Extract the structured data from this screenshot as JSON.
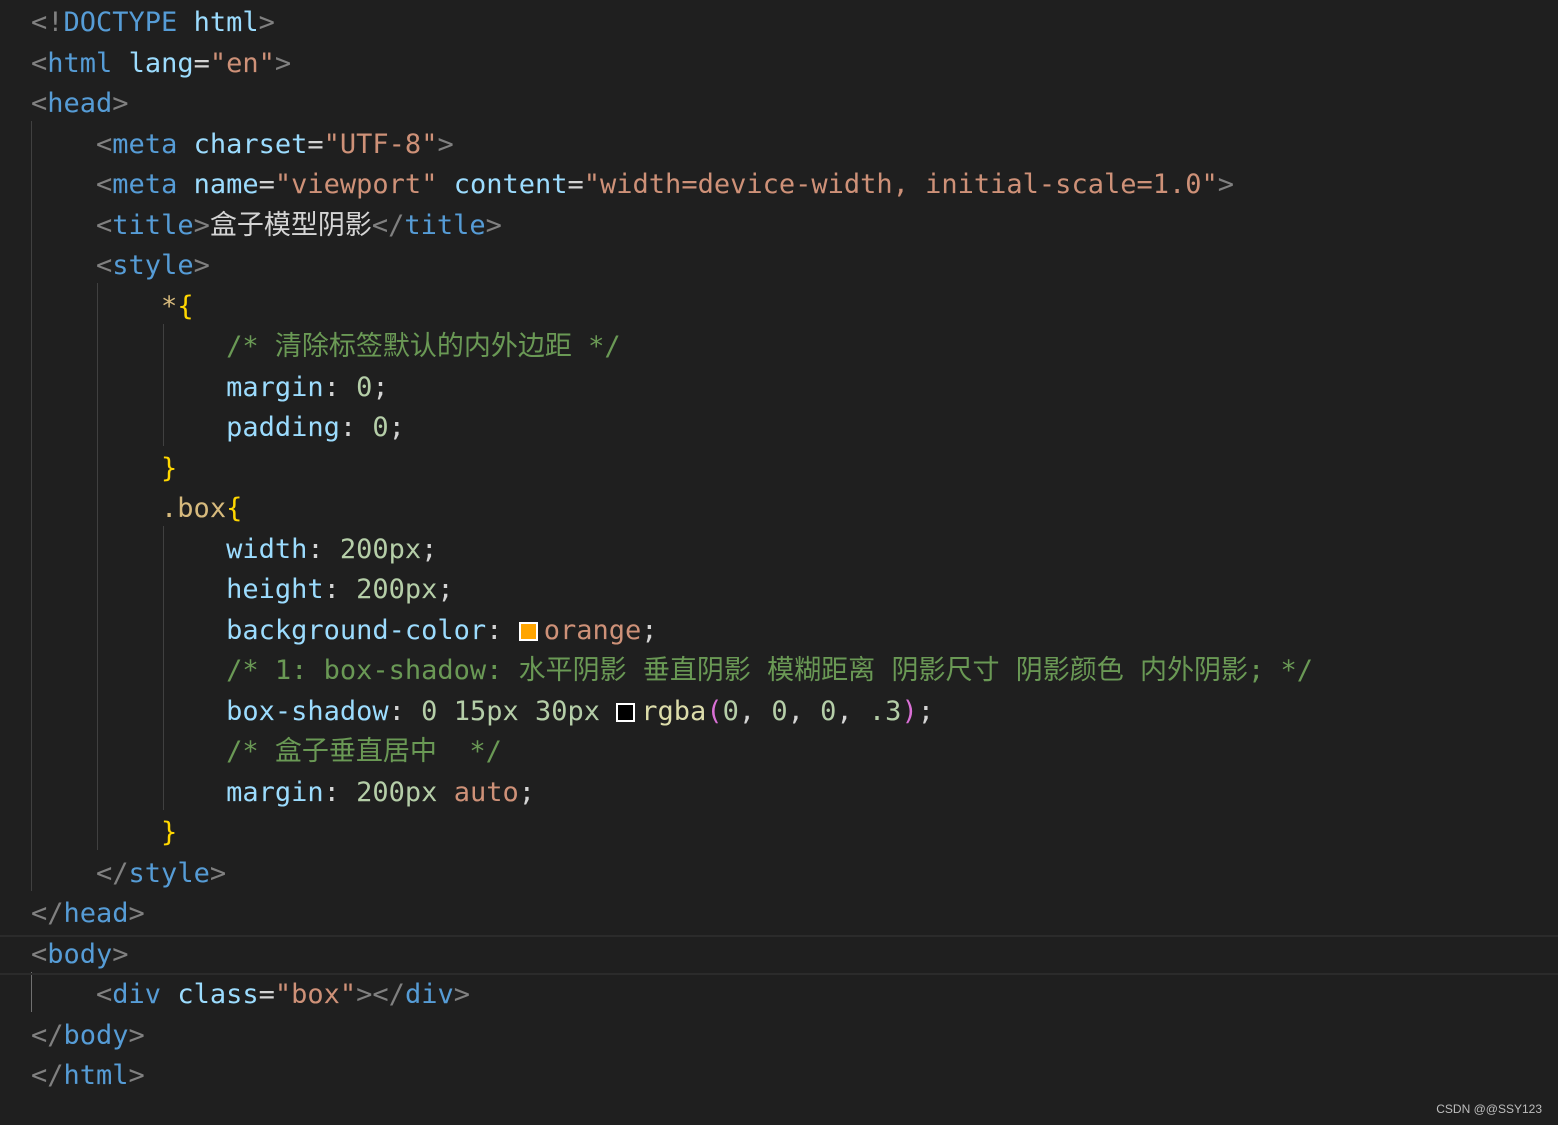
{
  "lines": [
    [
      {
        "c": "punc",
        "t": "<!"
      },
      {
        "c": "tag",
        "t": "DOCTYPE"
      },
      {
        "c": "text",
        "t": " "
      },
      {
        "c": "attr",
        "t": "html"
      },
      {
        "c": "punc",
        "t": ">"
      }
    ],
    [
      {
        "c": "punc",
        "t": "<"
      },
      {
        "c": "tag",
        "t": "html"
      },
      {
        "c": "text",
        "t": " "
      },
      {
        "c": "attr",
        "t": "lang"
      },
      {
        "c": "text",
        "t": "="
      },
      {
        "c": "str",
        "t": "\"en\""
      },
      {
        "c": "punc",
        "t": ">"
      }
    ],
    [
      {
        "c": "punc",
        "t": "<"
      },
      {
        "c": "tag",
        "t": "head"
      },
      {
        "c": "punc",
        "t": ">"
      }
    ],
    [
      {
        "c": "text",
        "t": "    "
      },
      {
        "c": "punc",
        "t": "<"
      },
      {
        "c": "tag",
        "t": "meta"
      },
      {
        "c": "text",
        "t": " "
      },
      {
        "c": "attr",
        "t": "charset"
      },
      {
        "c": "text",
        "t": "="
      },
      {
        "c": "str",
        "t": "\"UTF-8\""
      },
      {
        "c": "punc",
        "t": ">"
      }
    ],
    [
      {
        "c": "text",
        "t": "    "
      },
      {
        "c": "punc",
        "t": "<"
      },
      {
        "c": "tag",
        "t": "meta"
      },
      {
        "c": "text",
        "t": " "
      },
      {
        "c": "attr",
        "t": "name"
      },
      {
        "c": "text",
        "t": "="
      },
      {
        "c": "str",
        "t": "\"viewport\""
      },
      {
        "c": "text",
        "t": " "
      },
      {
        "c": "attr",
        "t": "content"
      },
      {
        "c": "text",
        "t": "="
      },
      {
        "c": "str",
        "t": "\"width=device-width, initial-scale=1.0\""
      },
      {
        "c": "punc",
        "t": ">"
      }
    ],
    [
      {
        "c": "text",
        "t": "    "
      },
      {
        "c": "punc",
        "t": "<"
      },
      {
        "c": "tag",
        "t": "title"
      },
      {
        "c": "punc",
        "t": ">"
      },
      {
        "c": "text",
        "t": "盒子模型阴影"
      },
      {
        "c": "punc",
        "t": "</"
      },
      {
        "c": "tag",
        "t": "title"
      },
      {
        "c": "punc",
        "t": ">"
      }
    ],
    [
      {
        "c": "text",
        "t": "    "
      },
      {
        "c": "punc",
        "t": "<"
      },
      {
        "c": "tag",
        "t": "style"
      },
      {
        "c": "punc",
        "t": ">"
      }
    ],
    [
      {
        "c": "text",
        "t": "        "
      },
      {
        "c": "sel",
        "t": "*"
      },
      {
        "c": "brace",
        "t": "{"
      }
    ],
    [
      {
        "c": "text",
        "t": "            "
      },
      {
        "c": "com",
        "t": "/* 清除标签默认的内外边距 */"
      }
    ],
    [
      {
        "c": "text",
        "t": "            "
      },
      {
        "c": "prop",
        "t": "margin"
      },
      {
        "c": "text",
        "t": ": "
      },
      {
        "c": "num",
        "t": "0"
      },
      {
        "c": "text",
        "t": ";"
      }
    ],
    [
      {
        "c": "text",
        "t": "            "
      },
      {
        "c": "prop",
        "t": "padding"
      },
      {
        "c": "text",
        "t": ": "
      },
      {
        "c": "num",
        "t": "0"
      },
      {
        "c": "text",
        "t": ";"
      }
    ],
    [
      {
        "c": "text",
        "t": "        "
      },
      {
        "c": "brace",
        "t": "}"
      }
    ],
    [
      {
        "c": "text",
        "t": "        "
      },
      {
        "c": "sel",
        "t": ".box"
      },
      {
        "c": "brace",
        "t": "{"
      }
    ],
    [
      {
        "c": "text",
        "t": "            "
      },
      {
        "c": "prop",
        "t": "width"
      },
      {
        "c": "text",
        "t": ": "
      },
      {
        "c": "num",
        "t": "200px"
      },
      {
        "c": "text",
        "t": ";"
      }
    ],
    [
      {
        "c": "text",
        "t": "            "
      },
      {
        "c": "prop",
        "t": "height"
      },
      {
        "c": "text",
        "t": ": "
      },
      {
        "c": "num",
        "t": "200px"
      },
      {
        "c": "text",
        "t": ";"
      }
    ],
    [
      {
        "c": "text",
        "t": "            "
      },
      {
        "c": "prop",
        "t": "background-color"
      },
      {
        "c": "text",
        "t": ": "
      },
      {
        "c": "swatch",
        "t": "",
        "color": "#ffa500"
      },
      {
        "c": "val",
        "t": "orange"
      },
      {
        "c": "text",
        "t": ";"
      }
    ],
    [
      {
        "c": "text",
        "t": "            "
      },
      {
        "c": "com",
        "t": "/* 1: box-shadow: 水平阴影 垂直阴影 模糊距离 阴影尺寸 阴影颜色 内外阴影; */"
      }
    ],
    [
      {
        "c": "text",
        "t": "            "
      },
      {
        "c": "prop",
        "t": "box-shadow"
      },
      {
        "c": "text",
        "t": ": "
      },
      {
        "c": "num",
        "t": "0"
      },
      {
        "c": "text",
        "t": " "
      },
      {
        "c": "num",
        "t": "15px"
      },
      {
        "c": "text",
        "t": " "
      },
      {
        "c": "num",
        "t": "30px"
      },
      {
        "c": "text",
        "t": " "
      },
      {
        "c": "swatch",
        "t": "",
        "color": "#000000"
      },
      {
        "c": "fn",
        "t": "rgba"
      },
      {
        "c": "brace2",
        "t": "("
      },
      {
        "c": "num",
        "t": "0"
      },
      {
        "c": "text",
        "t": ", "
      },
      {
        "c": "num",
        "t": "0"
      },
      {
        "c": "text",
        "t": ", "
      },
      {
        "c": "num",
        "t": "0"
      },
      {
        "c": "text",
        "t": ", "
      },
      {
        "c": "num",
        "t": ".3"
      },
      {
        "c": "brace2",
        "t": ")"
      },
      {
        "c": "text",
        "t": ";"
      }
    ],
    [
      {
        "c": "text",
        "t": "            "
      },
      {
        "c": "com",
        "t": "/* 盒子垂直居中  */"
      }
    ],
    [
      {
        "c": "text",
        "t": "            "
      },
      {
        "c": "prop",
        "t": "margin"
      },
      {
        "c": "text",
        "t": ": "
      },
      {
        "c": "num",
        "t": "200px"
      },
      {
        "c": "text",
        "t": " "
      },
      {
        "c": "val",
        "t": "auto"
      },
      {
        "c": "text",
        "t": ";"
      }
    ],
    [
      {
        "c": "text",
        "t": "        "
      },
      {
        "c": "brace",
        "t": "}"
      }
    ],
    [
      {
        "c": "text",
        "t": "    "
      },
      {
        "c": "punc",
        "t": "</"
      },
      {
        "c": "tag",
        "t": "style"
      },
      {
        "c": "punc",
        "t": ">"
      }
    ],
    [
      {
        "c": "punc",
        "t": "</"
      },
      {
        "c": "tag",
        "t": "head"
      },
      {
        "c": "punc",
        "t": ">"
      }
    ],
    [
      {
        "c": "punc",
        "t": "<"
      },
      {
        "c": "tag",
        "t": "body"
      },
      {
        "c": "punc",
        "t": ">"
      }
    ],
    [
      {
        "c": "text",
        "t": "    "
      },
      {
        "c": "punc",
        "t": "<"
      },
      {
        "c": "tag",
        "t": "div"
      },
      {
        "c": "text",
        "t": " "
      },
      {
        "c": "attr",
        "t": "class"
      },
      {
        "c": "text",
        "t": "="
      },
      {
        "c": "str",
        "t": "\"box\""
      },
      {
        "c": "punc",
        "t": "></"
      },
      {
        "c": "tag",
        "t": "div"
      },
      {
        "c": "punc",
        "t": ">"
      }
    ],
    [
      {
        "c": "punc",
        "t": "</"
      },
      {
        "c": "tag",
        "t": "body"
      },
      {
        "c": "punc",
        "t": ">"
      }
    ],
    [
      {
        "c": "punc",
        "t": "</"
      },
      {
        "c": "tag",
        "t": "html"
      },
      {
        "c": "punc",
        "t": ">"
      }
    ]
  ],
  "active_line": 23,
  "watermark": "CSDN @@SSY123",
  "colors": {
    "background": "#1f1f1f",
    "tag": "#569cd6",
    "attribute": "#9cdcfe",
    "string": "#ce9178",
    "comment": "#6a9955",
    "number": "#b5cea8",
    "selector": "#d7ba7d",
    "brace": "#ffd700",
    "function": "#dcdcaa"
  }
}
